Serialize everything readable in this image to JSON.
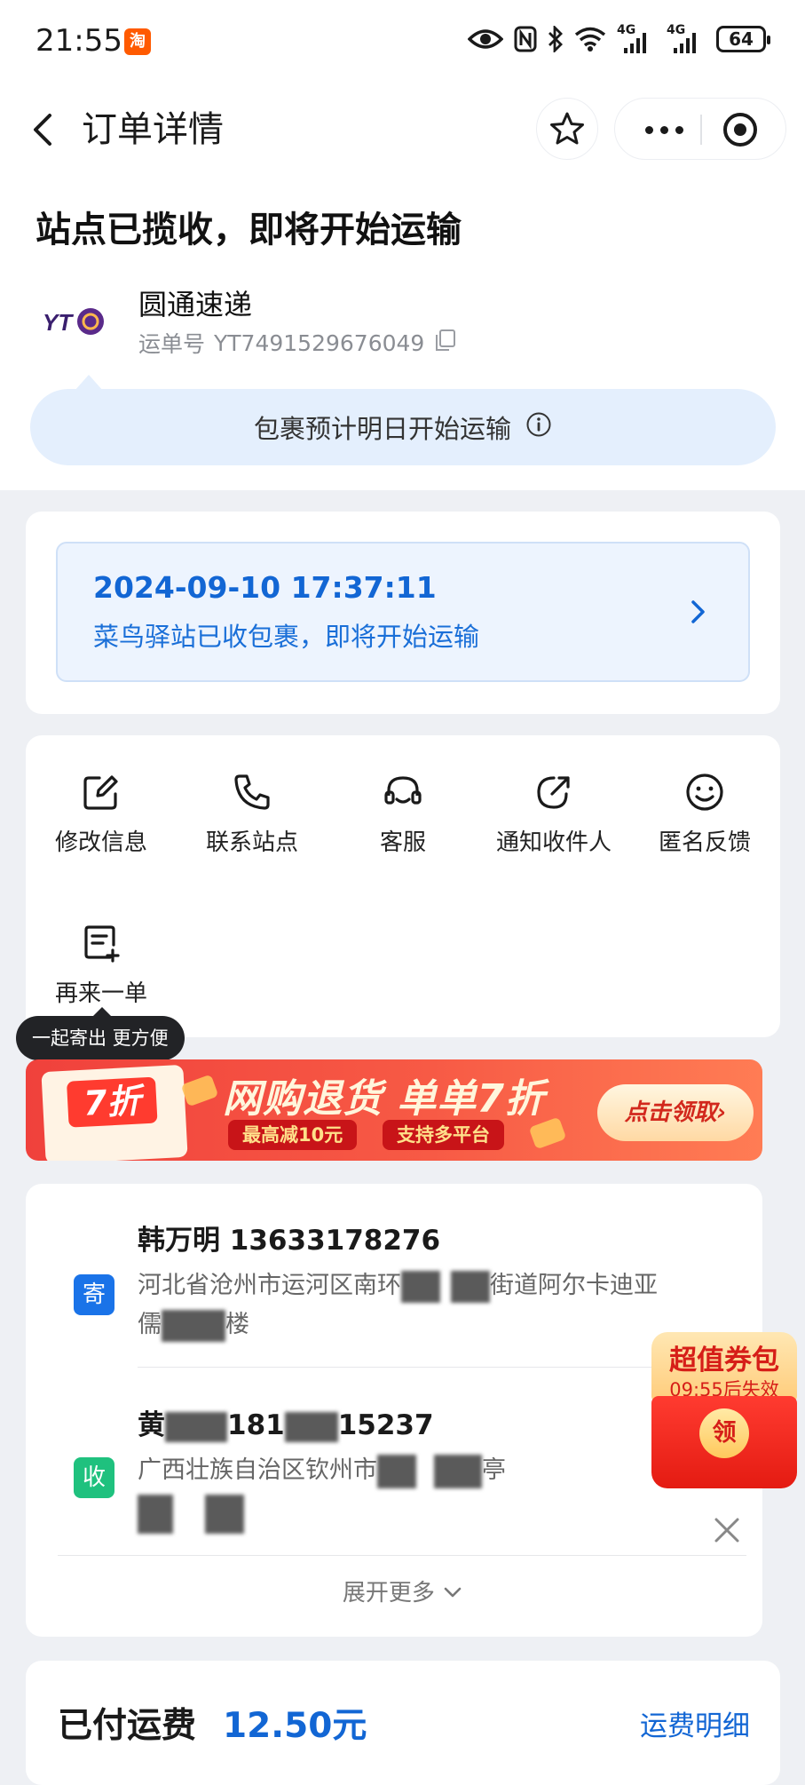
{
  "status_bar": {
    "time": "21:55",
    "app_icon_char": "淘",
    "network1": "4G",
    "network2": "4G",
    "battery": "64"
  },
  "nav": {
    "title": "订单详情"
  },
  "header": {
    "headline": "站点已揽收，即将开始运输",
    "carrier_name": "圆通速递",
    "carrier_logo_text": "YT",
    "waybill_label": "运单号",
    "waybill_number": "YT7491529676049",
    "tip": "包裹预计明日开始运输"
  },
  "tracking": {
    "time": "2024-09-10 17:37:11",
    "description": "菜鸟驿站已收包裹，即将开始运输"
  },
  "actions": [
    {
      "label": "修改信息",
      "icon": "edit-icon"
    },
    {
      "label": "联系站点",
      "icon": "phone-icon"
    },
    {
      "label": "客服",
      "icon": "headset-icon"
    },
    {
      "label": "通知收件人",
      "icon": "share-icon"
    },
    {
      "label": "匿名反馈",
      "icon": "smile-icon"
    },
    {
      "label": "再来一单",
      "icon": "reorder-icon"
    }
  ],
  "action_tooltip": "一起寄出 更方便",
  "promo": {
    "badge": "7折",
    "title": "网购退货 单单7折",
    "tag1": "最高减10元",
    "tag2": "支持多平台",
    "cta": "点击领取",
    "cta_arrow": "›"
  },
  "sender": {
    "badge": "寄",
    "name_phone": "韩万明 13633178276",
    "address_part1": "河北省沧州市运河区南环",
    "address_part2": "街道阿尔卡迪亚",
    "address_line2_a": "儒",
    "address_line2_b": "楼"
  },
  "receiver": {
    "badge": "收",
    "name_prefix": "黄",
    "phone_part1": "181",
    "phone_part2": "15237",
    "address_part1": "广西壮族自治区钦州市",
    "address_part2": "亭"
  },
  "expand_more": "展开更多",
  "coupon": {
    "title": "超值券包",
    "timer": "09:55后失效",
    "button": "领"
  },
  "fee": {
    "label": "已付运费",
    "amount": "12.50元",
    "link": "运费明细"
  },
  "colors": {
    "accent_blue": "#1266d4",
    "send_badge": "#1a73e8",
    "recv_badge": "#1fc17e",
    "promo_red": "#f0413c"
  }
}
